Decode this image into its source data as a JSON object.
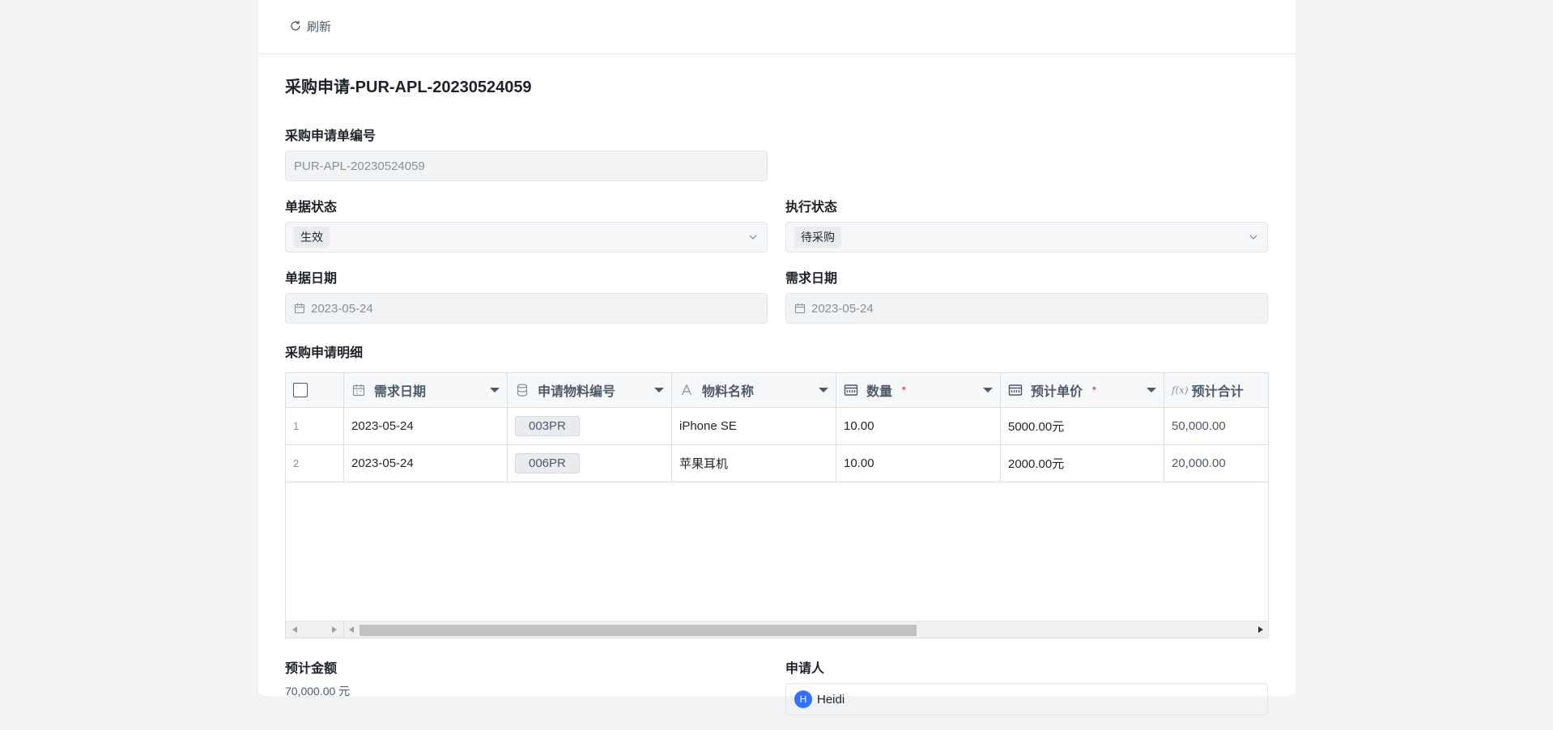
{
  "toolbar": {
    "refresh_label": "刷新"
  },
  "title": "采购申请-PUR-APL-20230524059",
  "fields": {
    "request_no": {
      "label": "采购申请单编号",
      "value": "PUR-APL-20230524059"
    },
    "doc_status": {
      "label": "单据状态",
      "value": "生效"
    },
    "exec_status": {
      "label": "执行状态",
      "value": "待采购"
    },
    "doc_date": {
      "label": "单据日期",
      "value": "2023-05-24"
    },
    "need_date": {
      "label": "需求日期",
      "value": "2023-05-24"
    }
  },
  "detail": {
    "label": "采购申请明细",
    "columns": [
      {
        "label": "需求日期",
        "icon": "calendar-icon",
        "required": false
      },
      {
        "label": "申请物料编号",
        "icon": "database-icon",
        "required": false
      },
      {
        "label": "物料名称",
        "icon": "text-icon",
        "required": false
      },
      {
        "label": "数量",
        "icon": "number-icon",
        "required": true
      },
      {
        "label": "预计单价",
        "icon": "number-icon",
        "required": true
      },
      {
        "label": "预计合计",
        "icon": "formula-icon",
        "required": false
      }
    ],
    "required_mark": "*",
    "formula_glyph": "f(x)",
    "rows": [
      {
        "no": "1",
        "date": "2023-05-24",
        "code": "003PR",
        "name": "iPhone SE",
        "qty": "10.00",
        "price": "5000.00元",
        "total": "50,000.00"
      },
      {
        "no": "2",
        "date": "2023-05-24",
        "code": "006PR",
        "name": "苹果耳机",
        "qty": "10.00",
        "price": "2000.00元",
        "total": "20,000.00"
      }
    ]
  },
  "footer": {
    "amount_label": "预计金额",
    "amount_value": "70,000.00 元",
    "applicant_label": "申请人",
    "applicant_name": "Heidi"
  }
}
